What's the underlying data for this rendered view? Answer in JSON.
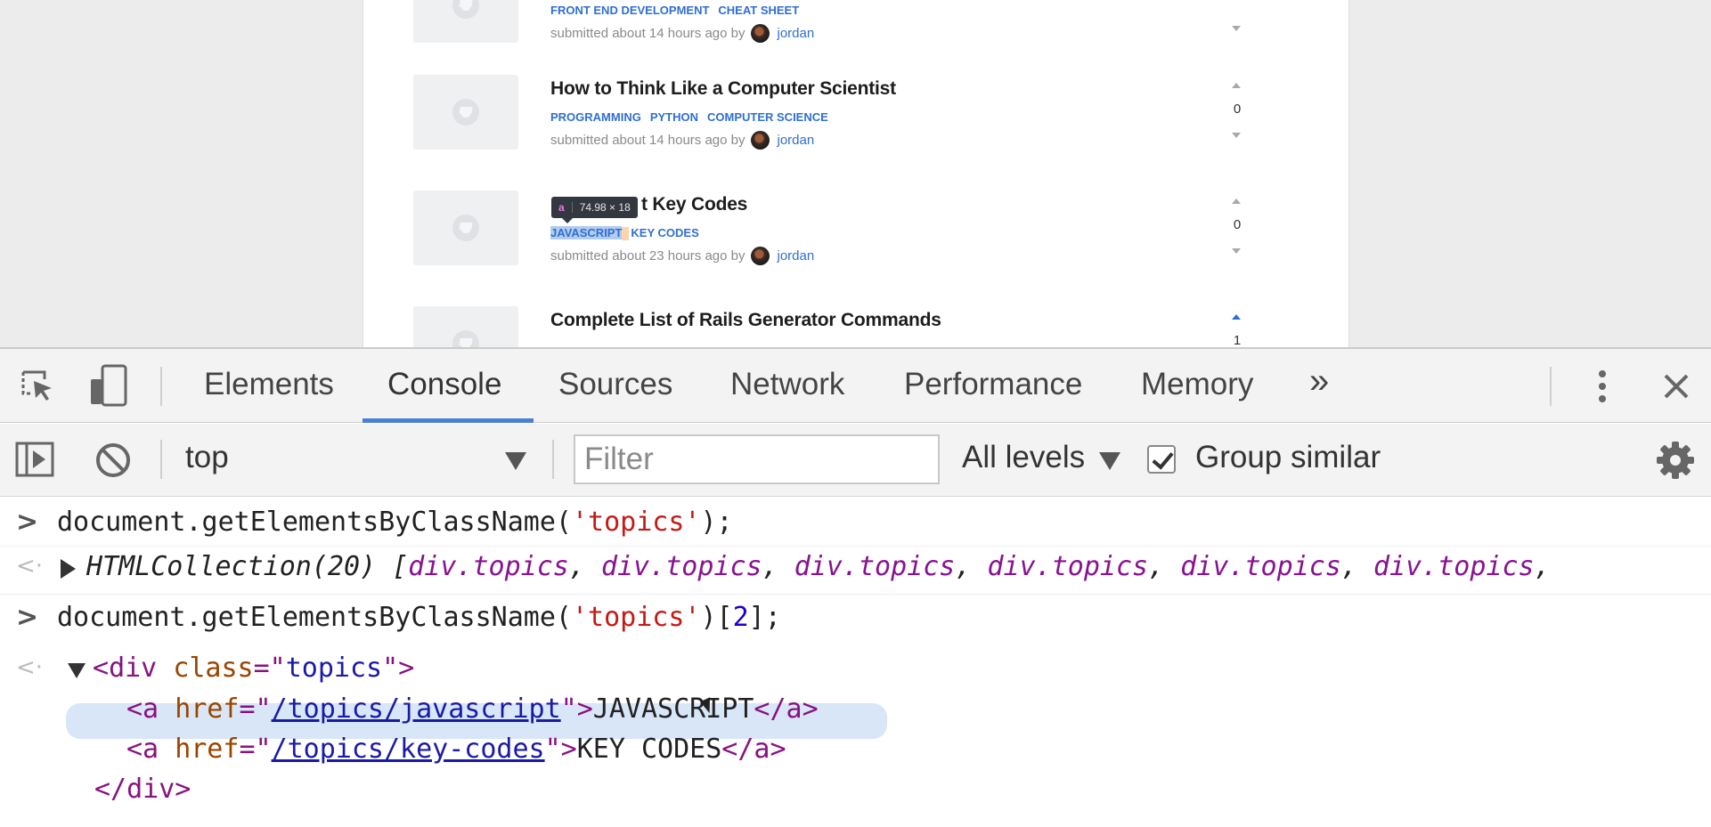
{
  "page": {
    "posts": [
      {
        "title": "",
        "tags": [
          "FRONT END DEVELOPMENT",
          "CHEAT SHEET"
        ],
        "submitted": "submitted about 14 hours ago by",
        "author": "jordan",
        "votes": ""
      },
      {
        "title": "How to Think Like a Computer Scientist",
        "tags": [
          "PROGRAMMING",
          "PYTHON",
          "COMPUTER SCIENCE"
        ],
        "submitted": "submitted about 14 hours ago by",
        "author": "jordan",
        "votes": "0"
      },
      {
        "title": "JavaScript Key Codes",
        "title_visible": "t Key Codes",
        "tags": [
          "JAVASCRIPT",
          "KEY CODES"
        ],
        "submitted": "submitted about 23 hours ago by",
        "author": "jordan",
        "votes": "0"
      },
      {
        "title": "Complete List of Rails Generator Commands",
        "tags": [],
        "submitted": "",
        "author": "",
        "votes": "1"
      }
    ],
    "inspect_tooltip": {
      "tag": "a",
      "size": "74.98 × 18"
    }
  },
  "devtools": {
    "tabs": [
      "Elements",
      "Console",
      "Sources",
      "Network",
      "Performance",
      "Memory"
    ],
    "active_tab": "Console",
    "more_tabs": "»",
    "toolbar": {
      "context": "top",
      "filter_placeholder": "Filter",
      "levels": "All levels",
      "group_similar": "Group similar",
      "group_similar_checked": true
    },
    "console": {
      "cmd1_prefix": "document.getElementsByClassName(",
      "cmd1_arg": "'topics'",
      "cmd1_suffix": ");",
      "result1_label": "HTMLCollection(20) [",
      "result1_item": "div.topics",
      "cmd2_prefix": "document.getElementsByClassName(",
      "cmd2_arg": "'topics'",
      "cmd2_index": "2",
      "cmd2_suffix": "];",
      "dom": {
        "div_open_tag": "div",
        "div_class_attr": "class",
        "div_class_val": "topics",
        "a1_href": "/topics/javascript",
        "a1_text": "JAVASCRIPT",
        "a2_href": "/topics/key-codes",
        "a2_text": "KEY CODES",
        "div_close": "</div>"
      }
    }
  },
  "colors": {
    "accent": "#4a7fd8",
    "tag_link": "#2f6fd0",
    "string": "#c41a16",
    "html_tag": "#881280",
    "attr_name": "#994500",
    "attr_value": "#1a1aa6"
  }
}
